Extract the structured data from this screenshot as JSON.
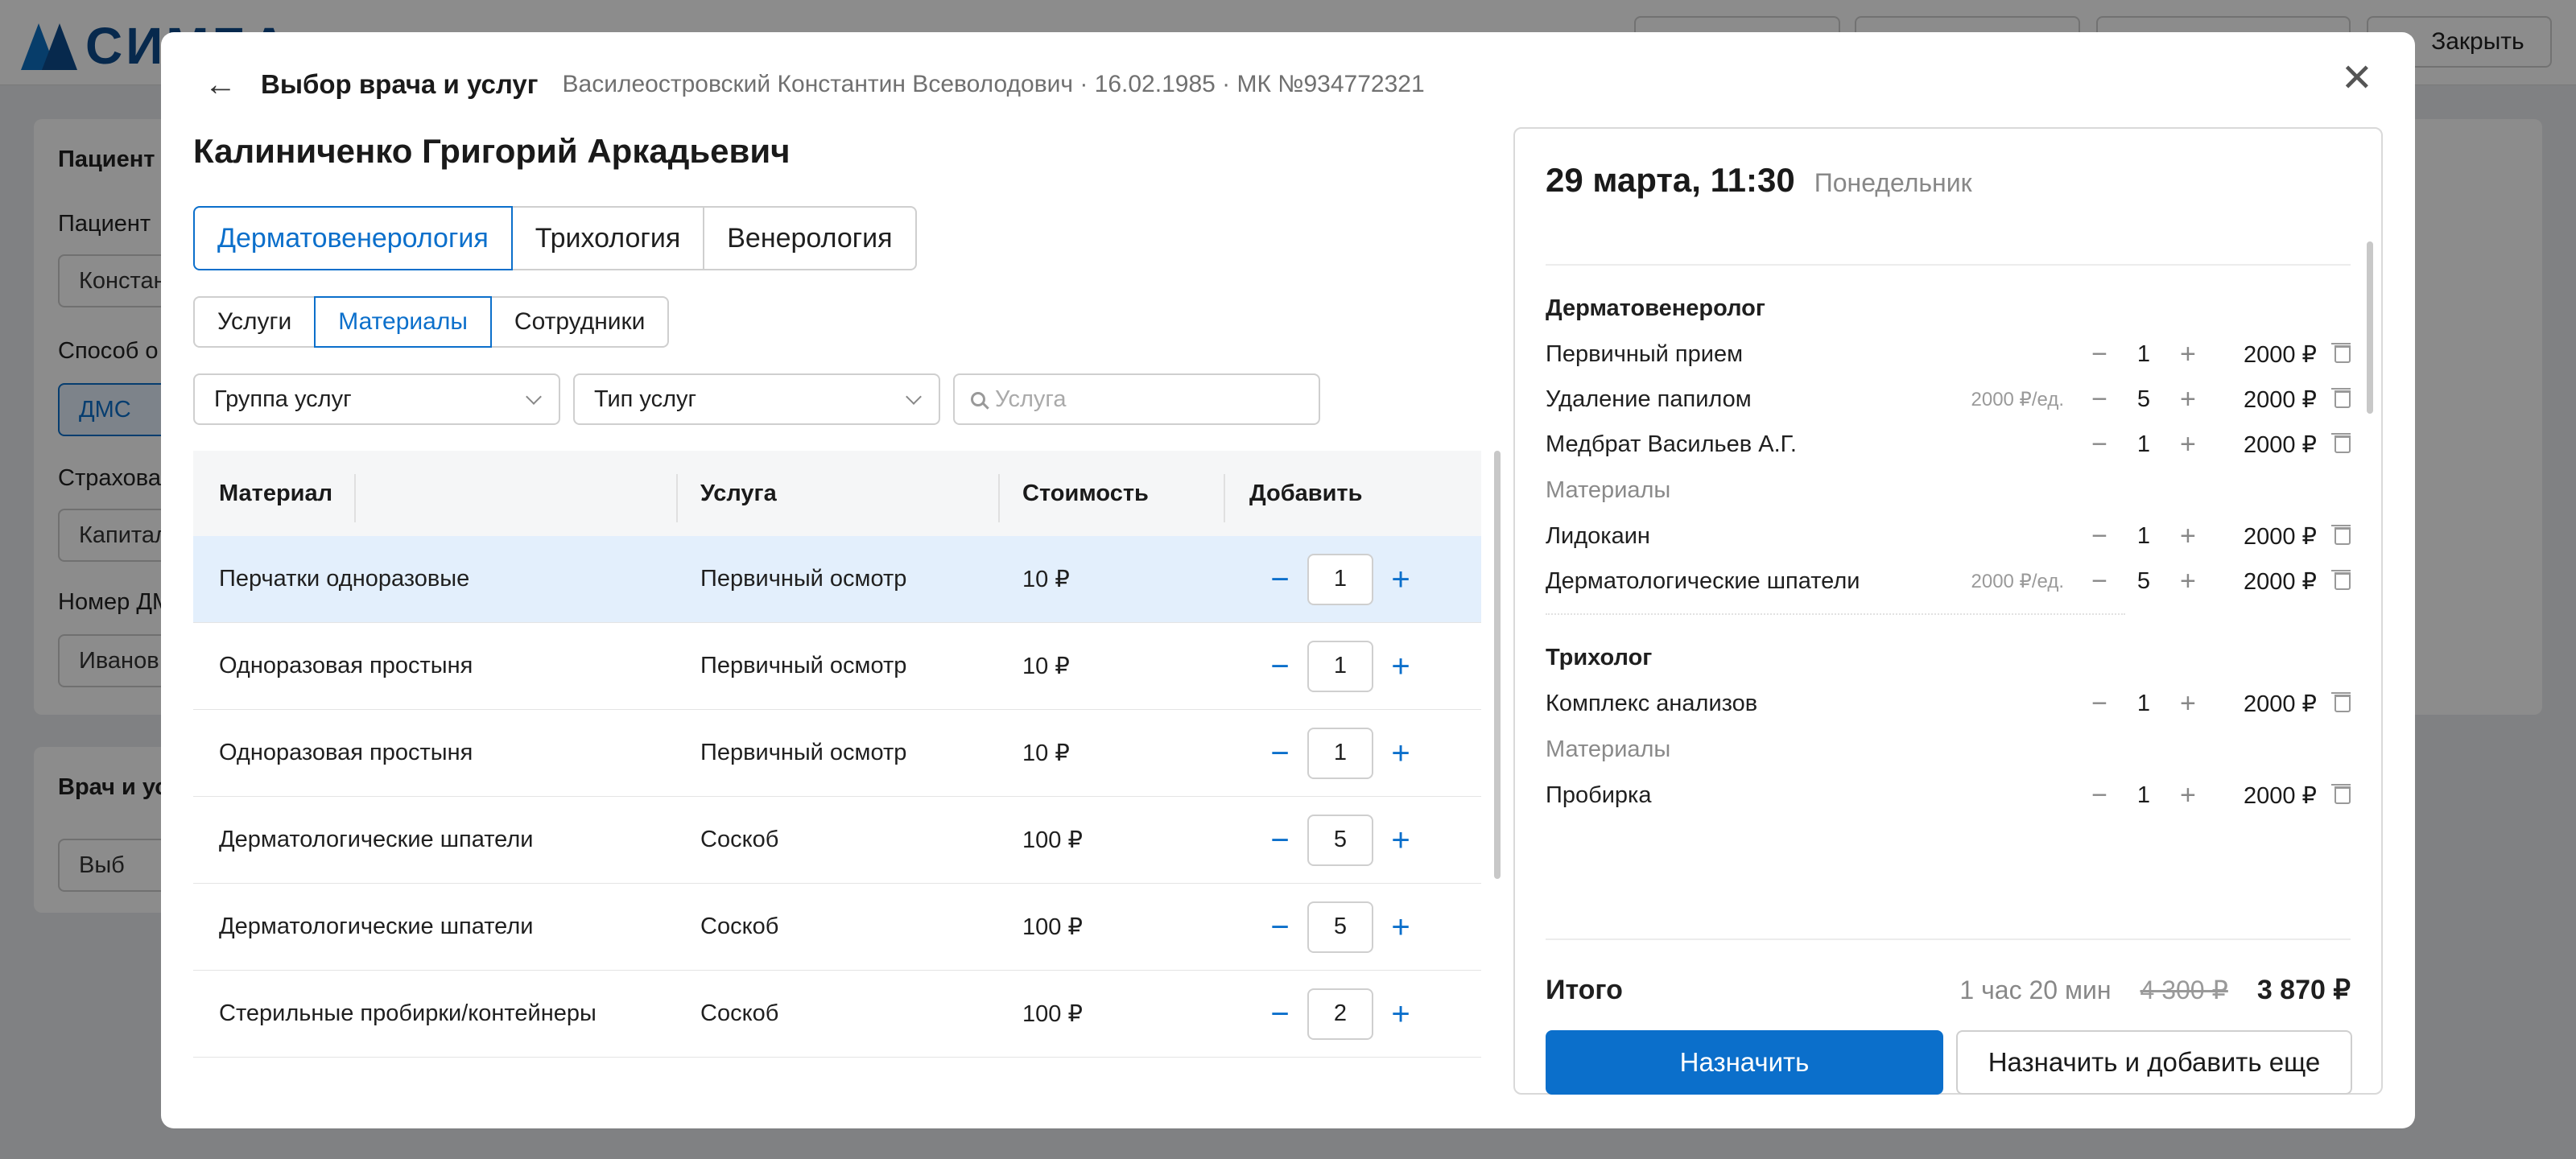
{
  "background": {
    "logo_text": "СИМБА",
    "close_button": "Закрыть",
    "patient_section_title": "Пациент",
    "labels": [
      "Пациент",
      "Способ о",
      "Страхова",
      "Номер ДМ"
    ],
    "fields": [
      "Констан",
      "Капитал",
      "Иванов"
    ],
    "dms_button": "ДМС",
    "doctor_section_title": "Врач и ус",
    "select_button": "Выб"
  },
  "modal": {
    "title": "Выбор врача и услуг",
    "patient_info": "Василеостровский Константин Всеволодович · 16.02.1985 · МК №934772321",
    "doctor_name": "Калиниченко Григорий Аркадьевич",
    "specialties": [
      "Дерматовенерология",
      "Трихология",
      "Венерология"
    ],
    "active_specialty": "Дерматовенерология",
    "tabs": [
      "Услуги",
      "Материалы",
      "Сотрудники"
    ],
    "active_tab": "Материалы",
    "filters": {
      "group": "Группа услуг",
      "type": "Тип услуг",
      "search_placeholder": "Услуга"
    },
    "table": {
      "headers": [
        "Материал",
        "Услуга",
        "Стоимость",
        "Добавить"
      ],
      "rows": [
        {
          "material": "Перчатки одноразовые",
          "service": "Первичный осмотр",
          "price": "10 ₽",
          "qty": "1"
        },
        {
          "material": "Одноразовая простыня",
          "service": "Первичный осмотр",
          "price": "10 ₽",
          "qty": "1"
        },
        {
          "material": "Одноразовая простыня",
          "service": "Первичный осмотр",
          "price": "10 ₽",
          "qty": "1"
        },
        {
          "material": "Дерматологические шпатели",
          "service": "Соскоб",
          "price": "100 ₽",
          "qty": "5"
        },
        {
          "material": "Дерматологические шпатели",
          "service": "Соскоб",
          "price": "100 ₽",
          "qty": "5"
        },
        {
          "material": "Стерильные пробирки/контейнеры",
          "service": "Соскоб",
          "price": "100 ₽",
          "qty": "2"
        }
      ]
    },
    "summary": {
      "date": "29 марта, 11:30",
      "weekday": "Понедельник",
      "groups": [
        {
          "title": "Дерматовенеролог",
          "items": [
            {
              "name": "Первичный прием",
              "unit": "",
              "qty": "1",
              "price": "2000 ₽"
            },
            {
              "name": "Удаление папилом",
              "unit": "2000 ₽/ед.",
              "qty": "5",
              "price": "2000 ₽"
            },
            {
              "name": "Медбрат Васильев А.Г.",
              "unit": "",
              "qty": "1",
              "price": "2000 ₽"
            }
          ],
          "materials_label": "Материалы",
          "materials": [
            {
              "name": "Лидокаин",
              "unit": "",
              "qty": "1",
              "price": "2000 ₽"
            },
            {
              "name": "Дерматологические шпатели",
              "unit": "2000 ₽/ед.",
              "qty": "5",
              "price": "2000 ₽"
            }
          ]
        },
        {
          "title": "Трихолог",
          "items": [
            {
              "name": "Комплекс анализов",
              "unit": "",
              "qty": "1",
              "price": "2000 ₽"
            }
          ],
          "materials_label": "Материалы",
          "materials": [
            {
              "name": "Пробирка",
              "unit": "",
              "qty": "1",
              "price": "2000 ₽"
            }
          ]
        }
      ],
      "total_label": "Итого",
      "duration": "1 час 20 мин",
      "old_price": "4 300 ₽",
      "new_price": "3 870 ₽",
      "assign_button": "Назначить",
      "assign_add_button": "Назначить и добавить еще"
    }
  },
  "colors": {
    "accent": "#0b6fcb",
    "selected_row": "#e3effc"
  }
}
